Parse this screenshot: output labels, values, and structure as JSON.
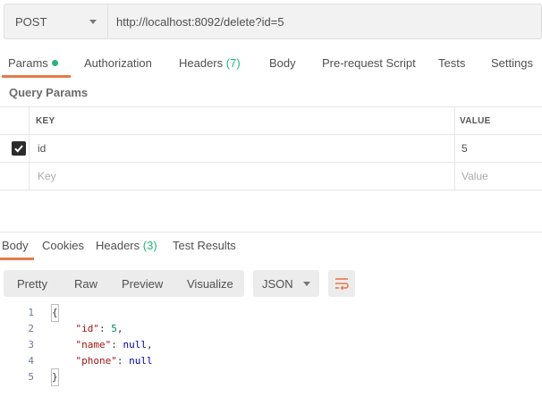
{
  "request": {
    "method": "POST",
    "url": "http://localhost:8092/delete?id=5"
  },
  "request_tabs": [
    {
      "label": "Params"
    },
    {
      "label": "Authorization"
    },
    {
      "label": "Headers",
      "count": "(7)"
    },
    {
      "label": "Body"
    },
    {
      "label": "Pre-request Script"
    },
    {
      "label": "Tests"
    },
    {
      "label": "Settings"
    }
  ],
  "query_params": {
    "title": "Query Params",
    "columns": {
      "key": "KEY",
      "value": "VALUE"
    },
    "rows": [
      {
        "checked": true,
        "key": "id",
        "value": "5"
      }
    ],
    "new_row": {
      "key_placeholder": "Key",
      "value_placeholder": "Value"
    }
  },
  "response_tabs": [
    {
      "label": "Body"
    },
    {
      "label": "Cookies"
    },
    {
      "label": "Headers",
      "count": "(3)"
    },
    {
      "label": "Test Results"
    }
  ],
  "view_modes": [
    "Pretty",
    "Raw",
    "Preview",
    "Visualize"
  ],
  "format": "JSON",
  "code_lines": [
    {
      "num": "1",
      "text": "{"
    },
    {
      "num": "2",
      "key": "\"id\"",
      "val": "5",
      "trail": ","
    },
    {
      "num": "3",
      "key": "\"name\"",
      "val": "null",
      "trail": ","
    },
    {
      "num": "4",
      "key": "\"phone\"",
      "val": "null",
      "trail": ""
    },
    {
      "num": "5",
      "text": "}"
    }
  ],
  "colors": {
    "accent": "#e8794a",
    "green": "#26b47f"
  }
}
